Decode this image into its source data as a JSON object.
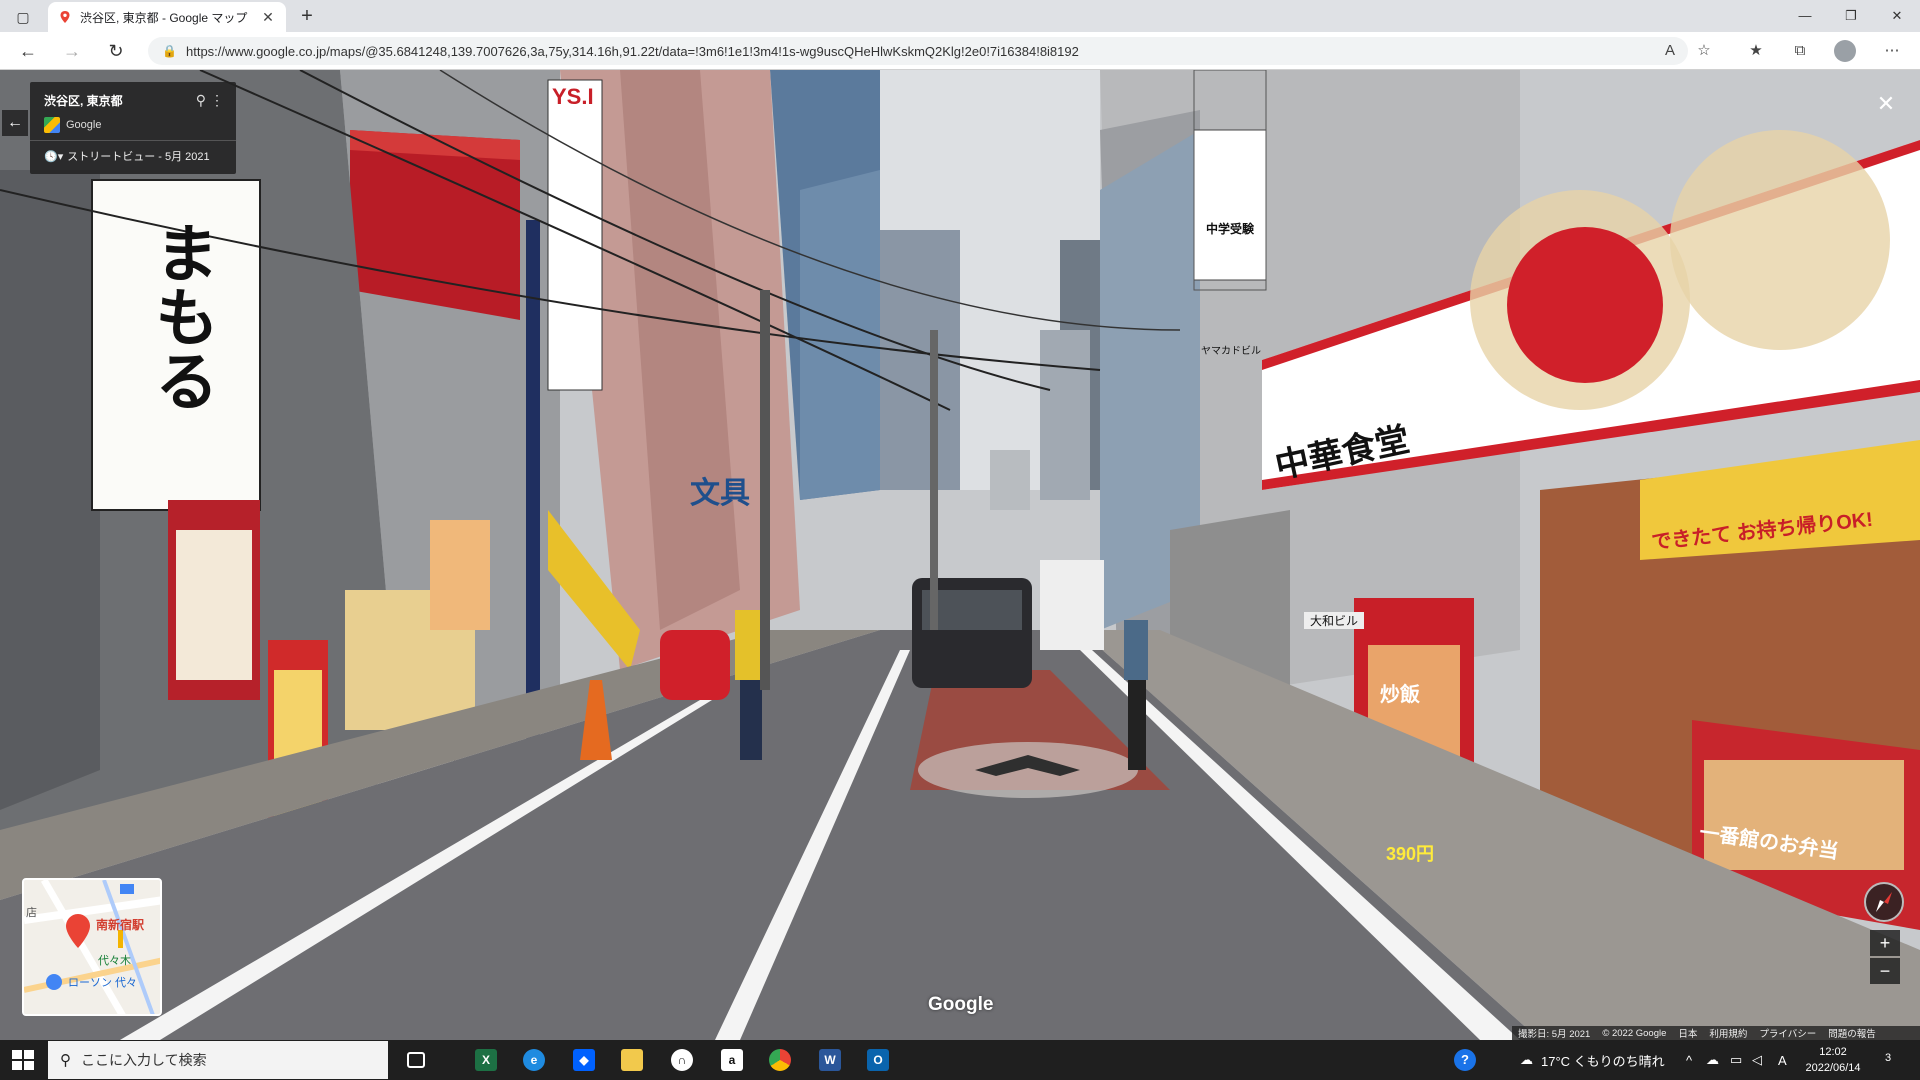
{
  "browser": {
    "tab_title": "渋谷区, 東京都 - Google マップ",
    "tab_close": "✕",
    "new_tab": "+",
    "url": "https://www.google.co.jp/maps/@35.6841248,139.7007626,3a,75y,314.16h,91.22t/data=!3m6!1e1!3m4!1s-wg9uscQHeHlwKskmQ2Klg!2e0!7i16384!8i8192",
    "win_minimize": "—",
    "win_restore": "❐",
    "win_close": "✕"
  },
  "streetview": {
    "place_name": "渋谷区, 東京都",
    "source": "Google",
    "history_label": "ストリートビュー - 5月 2021",
    "watermark": "Google",
    "footer": [
      "撮影日: 5月 2021",
      "© 2022 Google",
      "日本",
      "利用規約",
      "プライバシー",
      "問題の報告"
    ],
    "zoom_in": "+",
    "zoom_out": "−"
  },
  "minimap": {
    "label_station": "南新宿駅",
    "label_yoyogi": "代々木",
    "label_lawson": "ローソン 代々",
    "label_edge": "店"
  },
  "signs": {
    "ys": "YS.I",
    "mamoru": "まもる",
    "bunbougu": "文具",
    "chuka": "中華食堂",
    "ichiban": "一番館",
    "price": "390円",
    "dekitate": "できたて お持ち帰りOK!",
    "juken": "中学受験",
    "yamaka": "ヤマカドビル",
    "yamato": "大和ビル",
    "bento": "一番館のお弁当",
    "chahan": "炒飯"
  },
  "taskbar": {
    "search_placeholder": "ここに入力して検索",
    "weather": "17°C くもりのち晴れ",
    "time": "12:02",
    "date": "2022/06/14",
    "ime": "A",
    "notif_count": "3"
  },
  "colors": {
    "accent_red": "#d0202a",
    "road": "#6e6e72",
    "bike_lane": "#9a4b42"
  }
}
